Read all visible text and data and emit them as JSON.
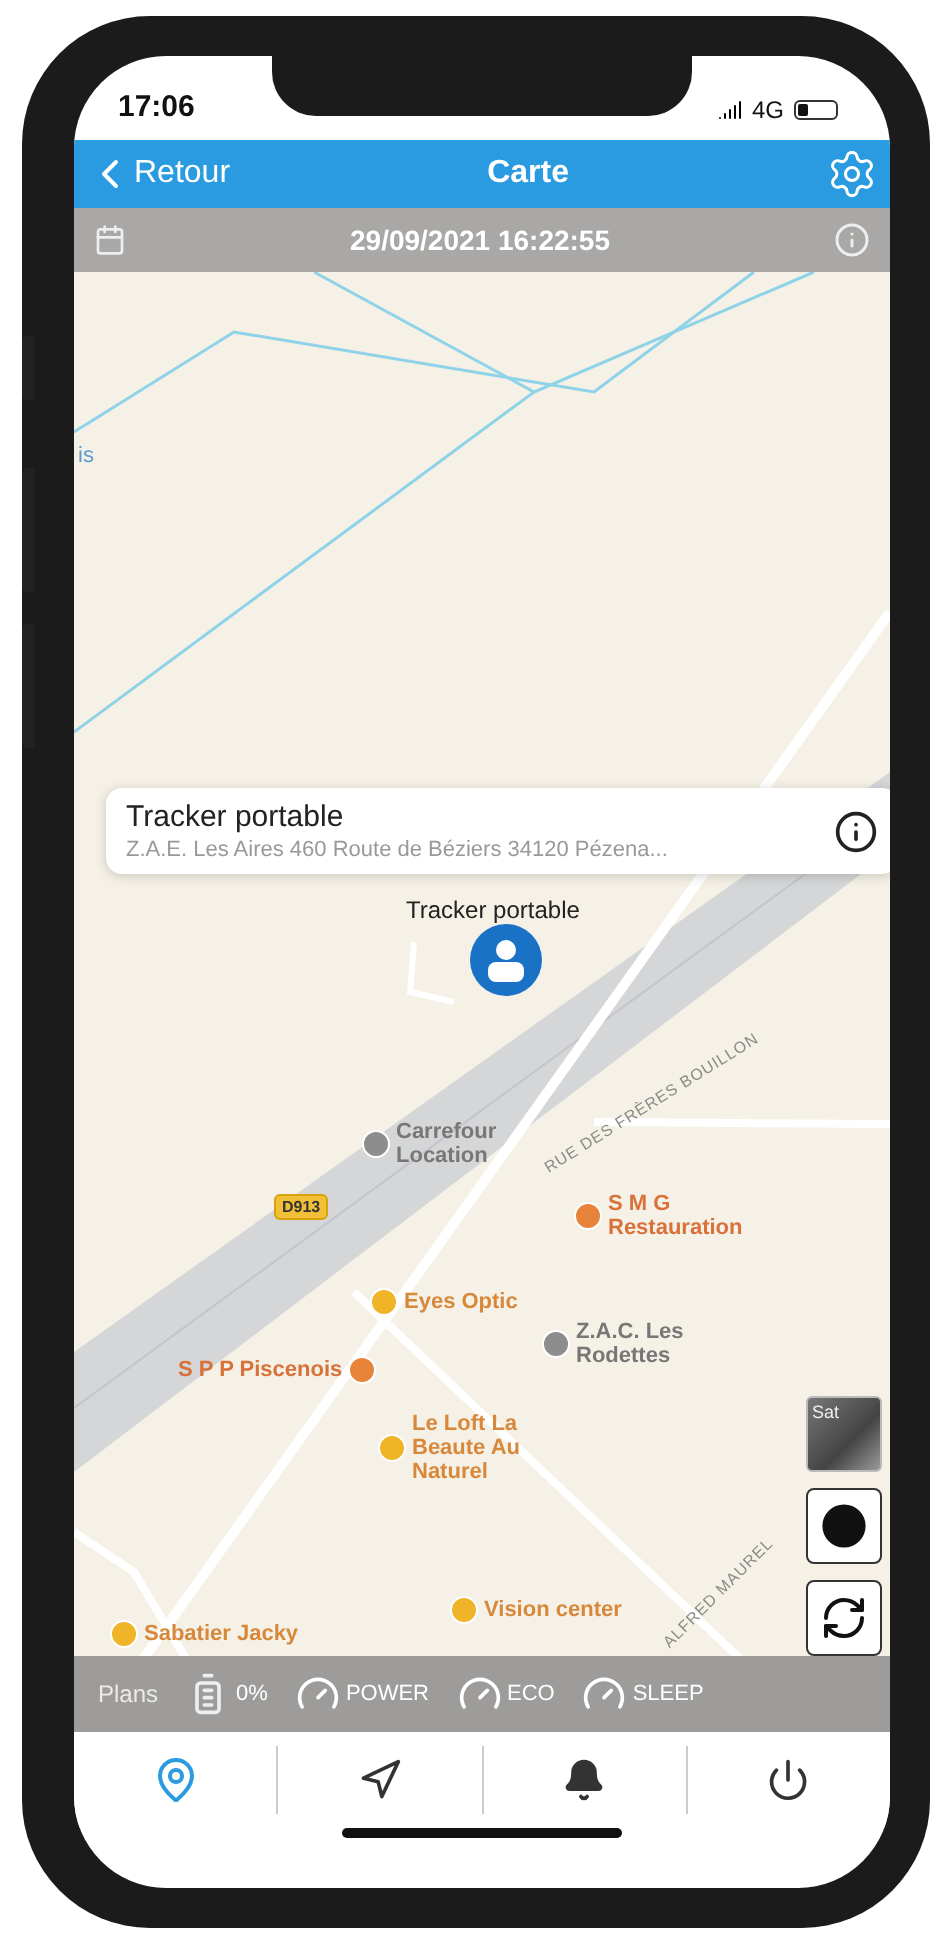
{
  "status_bar": {
    "time": "17:06",
    "network": "4G"
  },
  "nav_bar": {
    "back": "Retour",
    "title": "Carte"
  },
  "date_bar": {
    "datetime": "29/09/2021 16:22:55"
  },
  "map": {
    "callout": {
      "title": "Tracker portable",
      "address": "Z.A.E. Les Aires 460 Route de Béziers 34120 Pézena..."
    },
    "marker_label": "Tracker portable",
    "labels": [
      {
        "text": "is",
        "kind": "edge"
      },
      {
        "text": "Carrefour Location",
        "kind": "poi-gray"
      },
      {
        "text": "D913",
        "kind": "shield"
      },
      {
        "text": "RUE DES FRÈRES BOUILLON",
        "kind": "road"
      },
      {
        "text": "S M G Restauration",
        "kind": "poi-orange"
      },
      {
        "text": "Eyes Optic",
        "kind": "poi-yellow"
      },
      {
        "text": "Z.A.C. Les Rodettes",
        "kind": "poi-gray"
      },
      {
        "text": "S P P Piscenois",
        "kind": "poi-orange-right"
      },
      {
        "text": "Le Loft La Beaute Au Naturel",
        "kind": "poi-yellow"
      },
      {
        "text": "Vision center",
        "kind": "poi-yellow"
      },
      {
        "text": "Sabatier Jacky",
        "kind": "poi-yellow"
      },
      {
        "text": "ALFRED MAUREL",
        "kind": "road"
      }
    ],
    "satellite_thumb": "Sat"
  },
  "mode_bar": {
    "legal": "Plans",
    "battery": "0%",
    "modes": [
      "POWER",
      "ECO",
      "SLEEP"
    ]
  },
  "tabs": [
    {
      "kind": "map",
      "selected": true
    },
    {
      "kind": "route",
      "selected": false
    },
    {
      "kind": "alerts",
      "selected": false
    },
    {
      "kind": "power",
      "selected": false
    }
  ]
}
